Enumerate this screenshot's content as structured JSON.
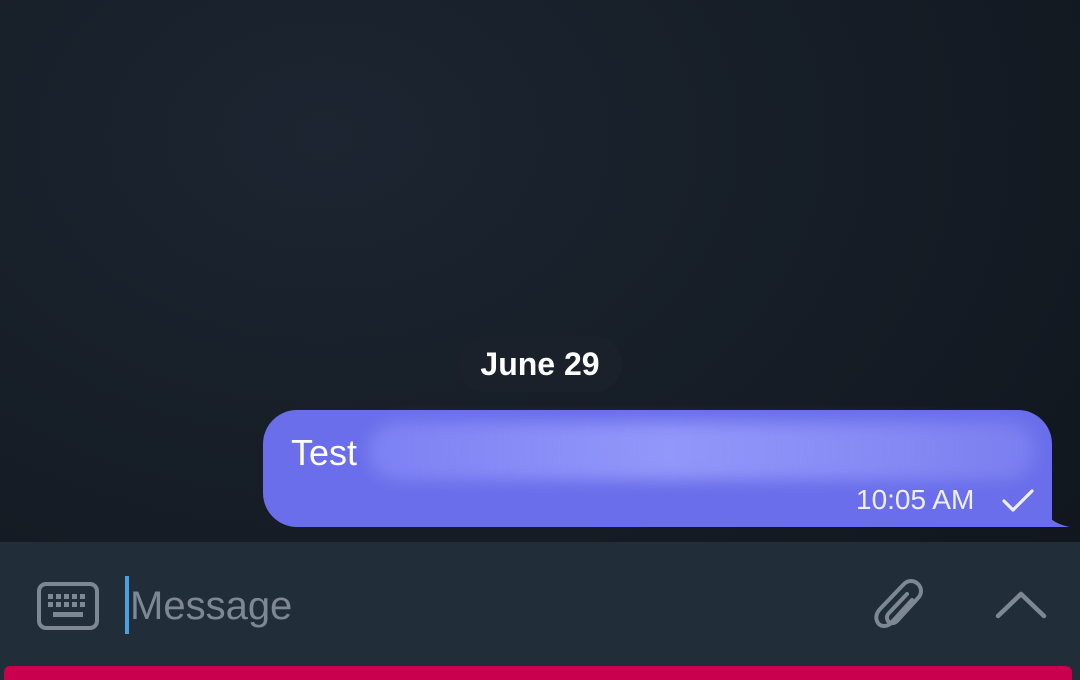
{
  "chat": {
    "date_separator": "June 29",
    "message": {
      "text": "Test",
      "time": "10:05 AM",
      "status_icon": "check-icon",
      "bubble_color": "#6a6eea"
    }
  },
  "composer": {
    "placeholder": "Message",
    "value": "",
    "left_icon": "keyboard-icon",
    "attach_icon": "paperclip-icon",
    "expand_icon": "chevron-up-icon"
  },
  "colors": {
    "background": "#151c25",
    "composer_background": "#222d3a",
    "caret": "#4a9fe0",
    "bottom_strip": "#c8004e"
  }
}
